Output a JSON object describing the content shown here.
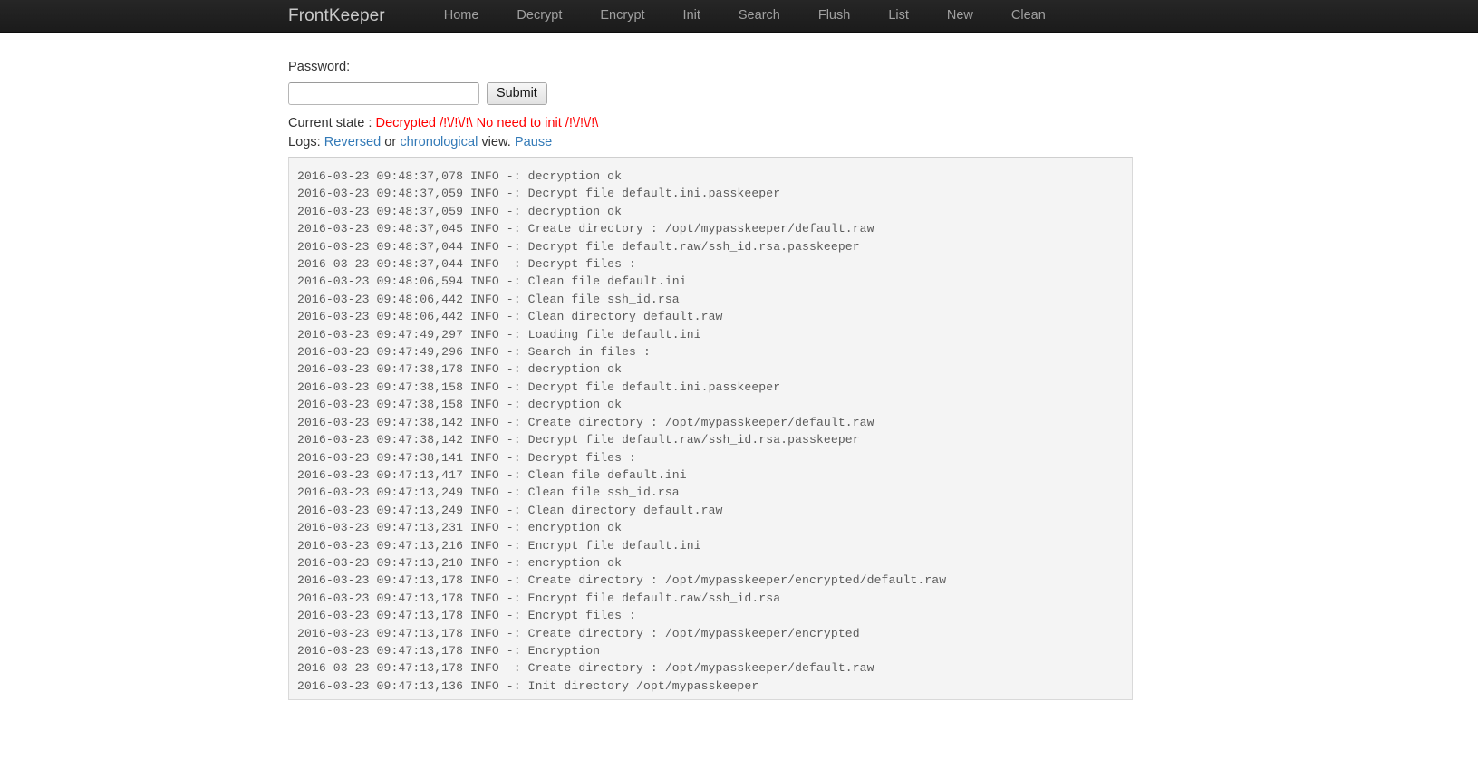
{
  "navbar": {
    "brand": "FrontKeeper",
    "links": [
      {
        "label": "Home"
      },
      {
        "label": "Decrypt"
      },
      {
        "label": "Encrypt"
      },
      {
        "label": "Init"
      },
      {
        "label": "Search"
      },
      {
        "label": "Flush"
      },
      {
        "label": "List"
      },
      {
        "label": "New"
      },
      {
        "label": "Clean"
      }
    ]
  },
  "form": {
    "password_label": "Password:",
    "password_value": "",
    "password_placeholder": "",
    "submit_label": "Submit"
  },
  "status": {
    "prefix": "Current state : ",
    "value": "Decrypted /!\\/!\\/!\\ No need to init /!\\/!\\/!\\",
    "color": "#ff0000"
  },
  "logs_controls": {
    "prefix": "Logs: ",
    "reversed_label": "Reversed",
    "or_label": " or ",
    "chronological_label": "chronological",
    "view_label": " view. ",
    "pause_label": "Pause",
    "link_color": "#337ab7"
  },
  "log_panel": {
    "lines": [
      "2016-03-23 09:48:37,078 INFO -: decryption ok",
      "2016-03-23 09:48:37,059 INFO -: Decrypt file default.ini.passkeeper",
      "2016-03-23 09:48:37,059 INFO -: decryption ok",
      "2016-03-23 09:48:37,045 INFO -: Create directory : /opt/mypasskeeper/default.raw",
      "2016-03-23 09:48:37,044 INFO -: Decrypt file default.raw/ssh_id.rsa.passkeeper",
      "2016-03-23 09:48:37,044 INFO -: Decrypt files :",
      "2016-03-23 09:48:06,594 INFO -: Clean file default.ini",
      "2016-03-23 09:48:06,442 INFO -: Clean file ssh_id.rsa",
      "2016-03-23 09:48:06,442 INFO -: Clean directory default.raw",
      "2016-03-23 09:47:49,297 INFO -: Loading file default.ini",
      "2016-03-23 09:47:49,296 INFO -: Search in files :",
      "2016-03-23 09:47:38,178 INFO -: decryption ok",
      "2016-03-23 09:47:38,158 INFO -: Decrypt file default.ini.passkeeper",
      "2016-03-23 09:47:38,158 INFO -: decryption ok",
      "2016-03-23 09:47:38,142 INFO -: Create directory : /opt/mypasskeeper/default.raw",
      "2016-03-23 09:47:38,142 INFO -: Decrypt file default.raw/ssh_id.rsa.passkeeper",
      "2016-03-23 09:47:38,141 INFO -: Decrypt files :",
      "2016-03-23 09:47:13,417 INFO -: Clean file default.ini",
      "2016-03-23 09:47:13,249 INFO -: Clean file ssh_id.rsa",
      "2016-03-23 09:47:13,249 INFO -: Clean directory default.raw",
      "2016-03-23 09:47:13,231 INFO -: encryption ok",
      "2016-03-23 09:47:13,216 INFO -: Encrypt file default.ini",
      "2016-03-23 09:47:13,210 INFO -: encryption ok",
      "2016-03-23 09:47:13,178 INFO -: Create directory : /opt/mypasskeeper/encrypted/default.raw",
      "2016-03-23 09:47:13,178 INFO -: Encrypt file default.raw/ssh_id.rsa",
      "2016-03-23 09:47:13,178 INFO -: Encrypt files :",
      "2016-03-23 09:47:13,178 INFO -: Create directory : /opt/mypasskeeper/encrypted",
      "2016-03-23 09:47:13,178 INFO -: Encryption",
      "2016-03-23 09:47:13,178 INFO -: Create directory : /opt/mypasskeeper/default.raw",
      "2016-03-23 09:47:13,136 INFO -: Init directory /opt/mypasskeeper"
    ]
  }
}
